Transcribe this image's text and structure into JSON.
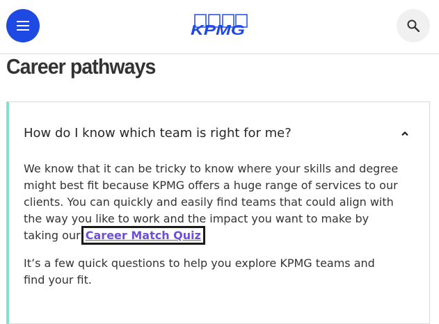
{
  "header": {
    "menu_icon": "hamburger-icon",
    "logo_text": "KPMG",
    "search_icon": "search-icon",
    "brand_color": "#1e49e2"
  },
  "page": {
    "title": "Career pathways"
  },
  "accordion": {
    "question": "How do I know which team is right for me?",
    "expanded": true,
    "accent_color": "#7fe3d3",
    "paragraph1_text": "We know that it can be tricky to know where your skills and degree might best fit because KPMG offers a huge range of services to our clients. You can quickly and easily find teams that could align with the way you like to work and the impact you want to make by taking our ",
    "paragraph1_link": "Career Match Quiz",
    "paragraph2_text": "It’s a few quick questions to help you explore KPMG teams and find your fit."
  }
}
